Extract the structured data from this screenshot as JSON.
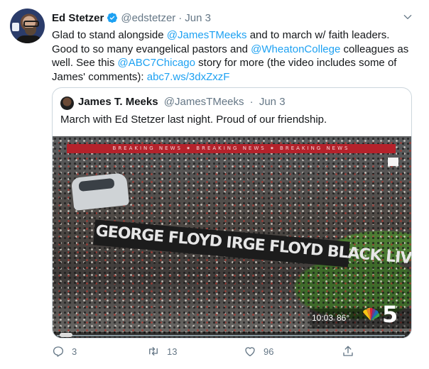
{
  "tweet": {
    "author_name": "Ed Stetzer",
    "author_handle": "@edstetzer",
    "separator": "·",
    "date": "Jun 3",
    "text_parts": {
      "t1": "Glad to stand alongside ",
      "m1": "@JamesTMeeks",
      "t2": " and to march w/ faith leaders. Good to so many evangelical pastors and ",
      "m2": "@WheatonCollege",
      "t3": " colleagues as well. See this ",
      "m3": "@ABC7Chicago",
      "t4": " story for more (the video includes some of James' comments): ",
      "link": "abc7.ws/3dxZxzF"
    },
    "icons": {
      "verified": "verified-badge-icon",
      "more": "chevron-down-icon"
    }
  },
  "quoted": {
    "author_name": "James T. Meeks",
    "author_handle": "@JamesTMeeks",
    "separator": "·",
    "date": "Jun 3",
    "text": "March with Ed Stetzer last night.  Proud of our friendship."
  },
  "video": {
    "ticker": "BREAKING NEWS ⁕ BREAKING NEWS ⁕ BREAKING NEWS",
    "banner_text": "GEORGE FLOYD  IRGE FLOYD  BLACK LIVE",
    "time": "10:03",
    "temperature": "86°",
    "channel_number": "5",
    "progress_fraction": 0.0
  },
  "actions": {
    "reply_count": "3",
    "retweet_count": "13",
    "like_count": "96",
    "icons": [
      "reply-icon",
      "retweet-icon",
      "like-icon",
      "share-icon"
    ]
  },
  "colors": {
    "link": "#1da1f2",
    "muted": "#657786",
    "border": "#ccd6dd",
    "ticker": "#b5222b"
  }
}
